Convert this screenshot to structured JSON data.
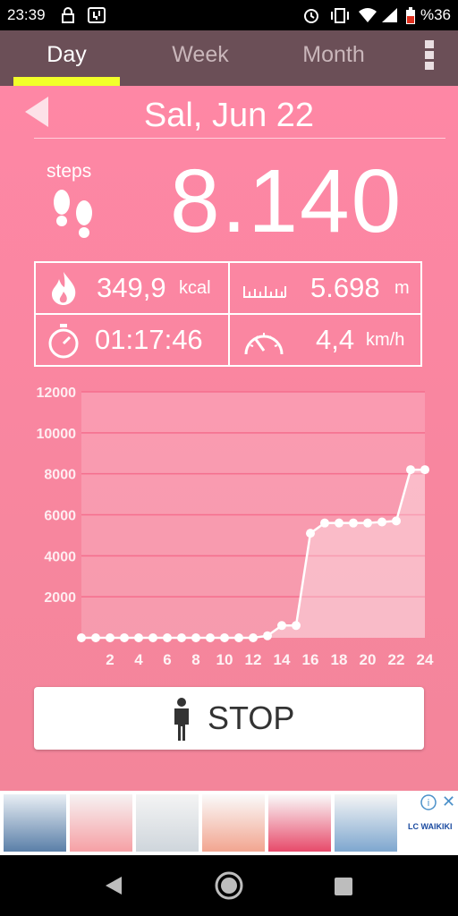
{
  "status_bar": {
    "time": "23:39",
    "battery": "%36"
  },
  "tabs": [
    {
      "label": "Day"
    },
    {
      "label": "Week"
    },
    {
      "label": "Month"
    }
  ],
  "date": "Sal, Jun 22",
  "steps": {
    "label": "steps",
    "value": "8.140"
  },
  "stats": {
    "calories": {
      "value": "349,9",
      "unit": "kcal"
    },
    "distance": {
      "value": "5.698",
      "unit": "m"
    },
    "duration": {
      "value": "01:17:46"
    },
    "speed": {
      "value": "4,4",
      "unit": "km/h"
    }
  },
  "chart_data": {
    "type": "area",
    "x": [
      0,
      1,
      2,
      3,
      4,
      5,
      6,
      7,
      8,
      9,
      10,
      11,
      12,
      13,
      14,
      15,
      16,
      17,
      18,
      19,
      20,
      21,
      22,
      23,
      24
    ],
    "series": [
      {
        "values": [
          0,
          0,
          0,
          0,
          0,
          0,
          0,
          0,
          0,
          0,
          0,
          0,
          0,
          100,
          600,
          600,
          5100,
          5600,
          5600,
          5600,
          5600,
          5650,
          5700,
          8200,
          8200
        ]
      }
    ],
    "xticks": [
      "2",
      "4",
      "6",
      "8",
      "10",
      "12",
      "14",
      "16",
      "18",
      "20",
      "22",
      "24"
    ],
    "yticks": [
      "2000",
      "4000",
      "6000",
      "8000",
      "10000",
      "12000"
    ],
    "ylim": [
      0,
      12000
    ],
    "xlim": [
      0,
      24
    ],
    "grid": true
  },
  "stop_button": {
    "label": "STOP"
  },
  "ad": {
    "brand": "LC WAIKIKI"
  },
  "colors": {
    "tab_bar": "#6b4f57",
    "accent": "#f2ff2a",
    "background": "#fe87a5"
  }
}
